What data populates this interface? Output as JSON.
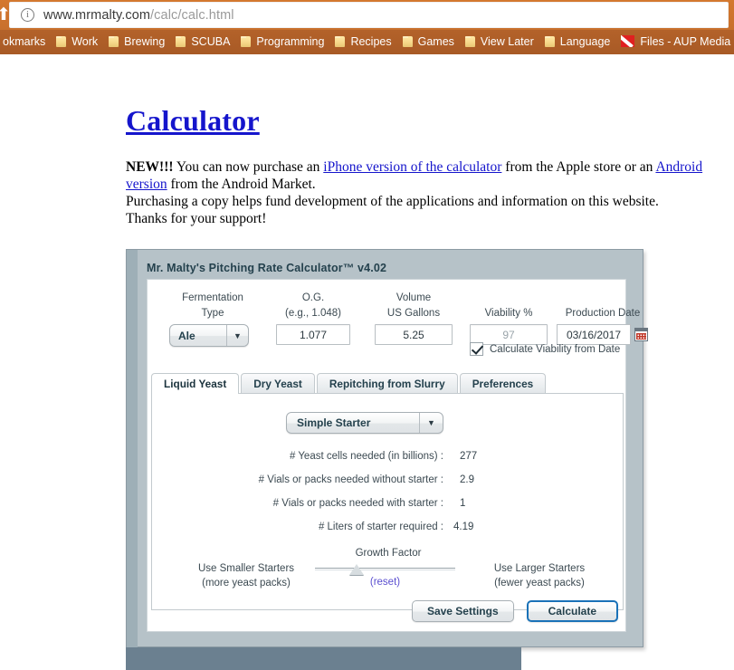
{
  "browser": {
    "back_icon": "back-arrow-icon",
    "info_icon": "info-circle-icon",
    "url_host": "www.mrmalty.com",
    "url_path": "/calc/calc.html",
    "bookmarks": [
      {
        "label": "okmarks",
        "icon": "folder-icon"
      },
      {
        "label": "Work",
        "icon": "folder-icon"
      },
      {
        "label": "Brewing",
        "icon": "folder-icon"
      },
      {
        "label": "SCUBA",
        "icon": "folder-icon"
      },
      {
        "label": "Programming",
        "icon": "folder-icon"
      },
      {
        "label": "Recipes",
        "icon": "folder-icon"
      },
      {
        "label": "Games",
        "icon": "folder-icon"
      },
      {
        "label": "View Later",
        "icon": "folder-icon"
      },
      {
        "label": "Language",
        "icon": "folder-icon"
      },
      {
        "label": "Files - AUP Media",
        "icon": "dive-flag-icon"
      }
    ]
  },
  "page": {
    "title": "Calculator",
    "intro": {
      "new_label": "NEW!!!",
      "line1_a": " You can now purchase an ",
      "link_iphone": "iPhone version of the calculator",
      "line1_b": " from the Apple store or an ",
      "link_android": "Android version",
      "line1_c": " from the Android Market.",
      "line2": "Purchasing a copy helps fund development of the applications and information on this website.",
      "line3": "Thanks for your support!"
    }
  },
  "calculator": {
    "header": "Mr. Malty's Pitching Rate Calculator™ v4.02",
    "fields": {
      "fermentation": {
        "label_line1": "Fermentation",
        "label_line2": "Type",
        "value": "Ale",
        "arrow_icon": "chevron-down-icon"
      },
      "og": {
        "label_line1": "O.G.",
        "label_line2": "(e.g., 1.048)",
        "value": "1.077"
      },
      "volume": {
        "label_line1": "Volume",
        "label_line2": "US Gallons",
        "value": "5.25"
      },
      "viability": {
        "label_line1": "",
        "label_line2": "Viability %",
        "value": "97"
      },
      "production_date": {
        "label_line1": "",
        "label_line2": "Production Date",
        "value": "03/16/2017",
        "calendar_icon": "calendar-icon"
      },
      "viability_checkbox": {
        "label": "Calculate Viability from Date",
        "checked": true,
        "check_icon": "checkmark-icon"
      }
    },
    "tabs": [
      {
        "label": "Liquid Yeast",
        "active": true
      },
      {
        "label": "Dry Yeast",
        "active": false
      },
      {
        "label": "Repitching from Slurry",
        "active": false
      },
      {
        "label": "Preferences",
        "active": false
      }
    ],
    "starter": {
      "value": "Simple Starter",
      "arrow_icon": "chevron-down-icon"
    },
    "results": [
      {
        "label": "# Yeast cells needed (in billions) :",
        "value": "277"
      },
      {
        "label": "# Vials or packs needed without starter :",
        "value": "2.9"
      },
      {
        "label": "# Vials or packs needed with starter :",
        "value": "1"
      },
      {
        "label": "# Liters of starter required :",
        "value": "4.19"
      }
    ],
    "growth_factor": {
      "title": "Growth Factor",
      "left_line1": "Use Smaller Starters",
      "left_line2": "(more yeast packs)",
      "right_line1": "Use Larger Starters",
      "right_line2": "(fewer yeast packs)",
      "reset_label": "(reset)"
    },
    "buttons": {
      "save": "Save Settings",
      "calculate": "Calculate"
    }
  },
  "colors": {
    "chrome": "#c8702c",
    "link": "#1515cc",
    "panel_bg": "#b6c2c8",
    "header_text": "#24414d",
    "accent_button_border": "#1a72b8",
    "reset_link": "#5b4fd0",
    "bookmark_folder": "#f7d98b",
    "dive_flag": "#e02020"
  }
}
